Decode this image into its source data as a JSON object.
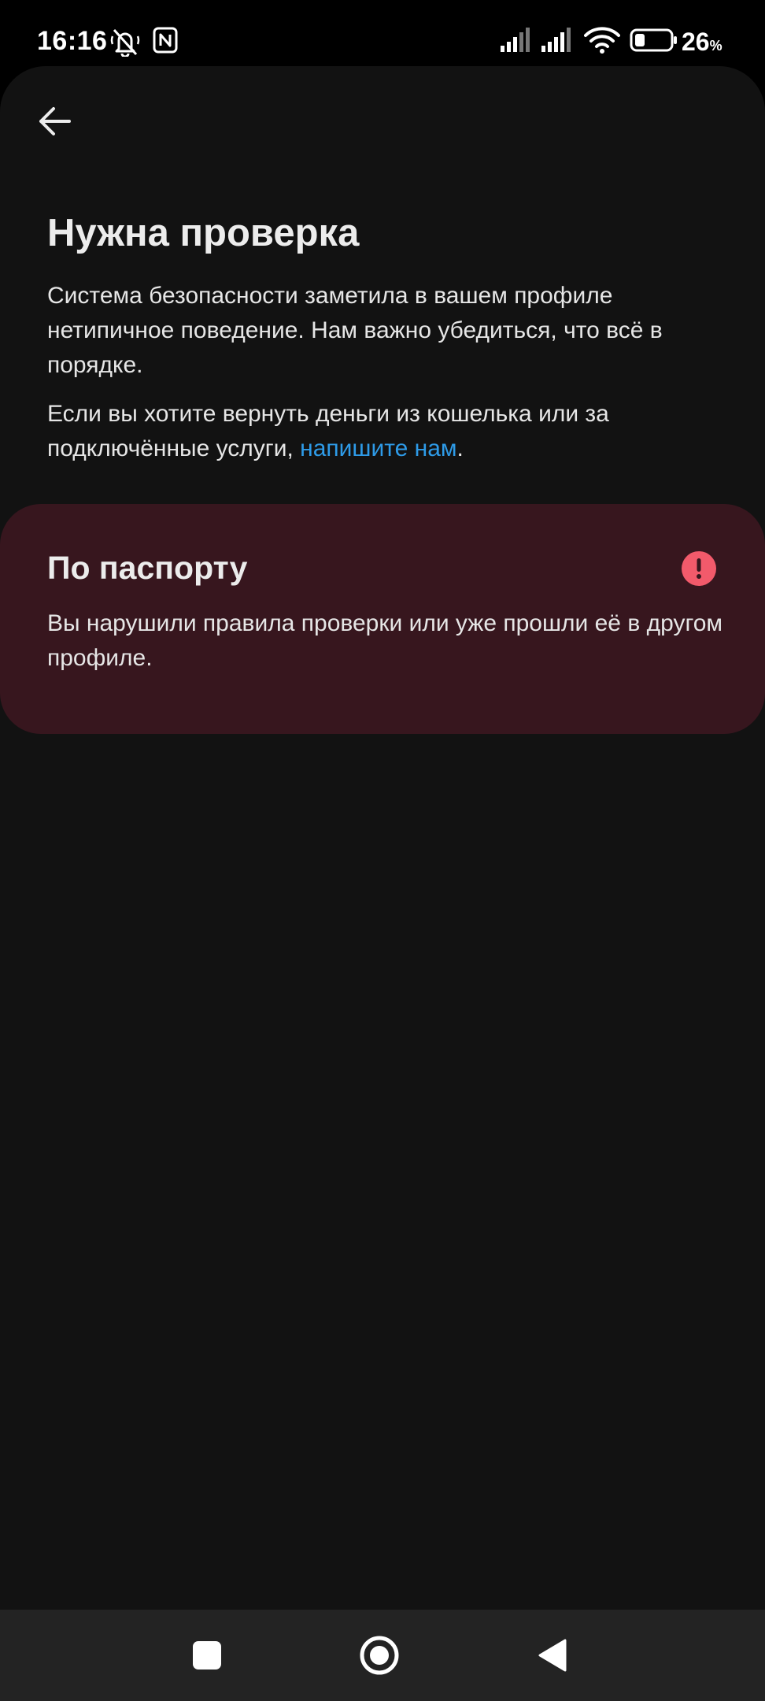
{
  "status_bar": {
    "time": "16:16",
    "battery_percent": "26",
    "battery_unit": "%",
    "icons": [
      "mute-alarm-icon",
      "nfc-icon",
      "signal-sim1-icon",
      "signal-sim2-icon",
      "wifi-icon",
      "battery-icon"
    ]
  },
  "header": {
    "back_icon": "arrow-left-icon"
  },
  "main": {
    "title": "Нужна проверка",
    "paragraph1": "Система безопасности заметила в вашем профиле нетипичное поведение. Нам важно убедиться, что всё в порядке.",
    "paragraph2_before": "Если вы хотите вернуть деньги из кошелька или за подключённые услуги, ",
    "paragraph2_link": "напишите нам",
    "paragraph2_after": "."
  },
  "card": {
    "title": "По паспорту",
    "text": "Вы нарушили правила проверки или уже прошли её в другом профиле.",
    "icon": "exclamation-circle-icon"
  },
  "navbar": {
    "icons": [
      "recents-square-icon",
      "home-circle-icon",
      "back-triangle-icon"
    ]
  },
  "colors": {
    "background": "#121212",
    "card_background": "#37161e",
    "link": "#2e9be8",
    "alert": "#f25a6b"
  }
}
